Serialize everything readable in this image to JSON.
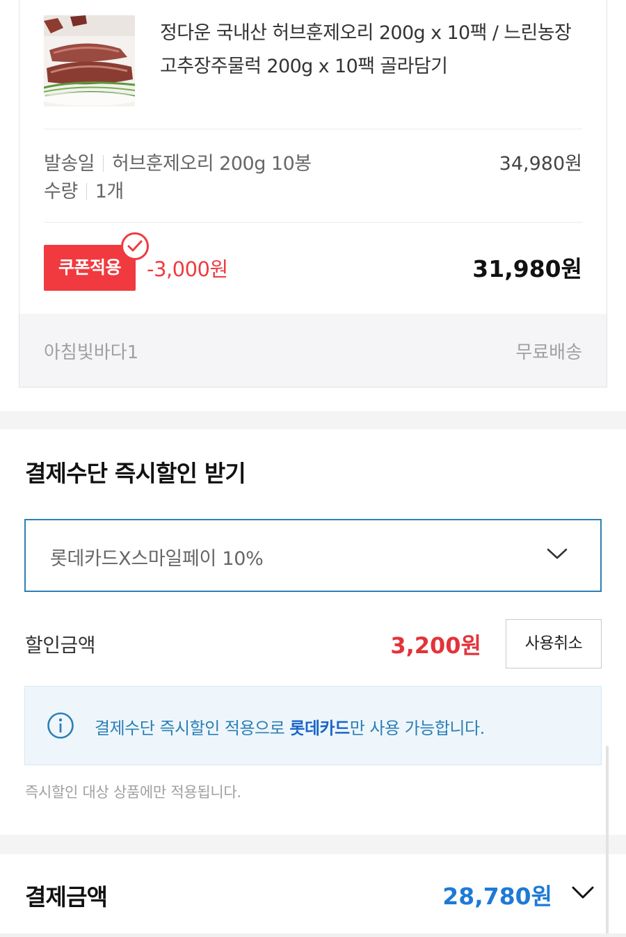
{
  "product": {
    "title_line1": "정다운 국내산 허브훈제오리 200g x 10팩 / 느린농장",
    "title_line2": "고추장주물럭 200g x 10팩 골라담기",
    "thumbnail_icon": "smoked-duck-photo"
  },
  "option": {
    "ship_label": "발송일",
    "option_name": "허브훈제오리 200g 10봉",
    "qty_label": "수량",
    "qty_value": "1개",
    "price": "34,980원"
  },
  "coupon": {
    "badge_label": "쿠폰적용",
    "discount": "-3,000원",
    "final_price": "31,980원",
    "badge_color": "#f03a3f"
  },
  "seller": {
    "name": "아침빛바다1",
    "shipping": "무료배송"
  },
  "payment_discount": {
    "title": "결제수단 즉시할인 받기",
    "selected_option": "롯데카드X스마일페이 10%",
    "discount_label": "할인금액",
    "discount_amount": "3,200원",
    "cancel_label": "사용취소",
    "notice_prefix": "결제수단 즉시할인 적용으로 ",
    "notice_bold": "롯데카드",
    "notice_suffix": "만 사용 가능합니다.",
    "footnote": "즉시할인 대상 상품에만 적용됩니다.",
    "accent_color": "#2c7fb4",
    "amount_color": "#e3333a"
  },
  "total": {
    "label": "결제금액",
    "amount": "28,780원",
    "amount_color": "#1e7ad6"
  }
}
